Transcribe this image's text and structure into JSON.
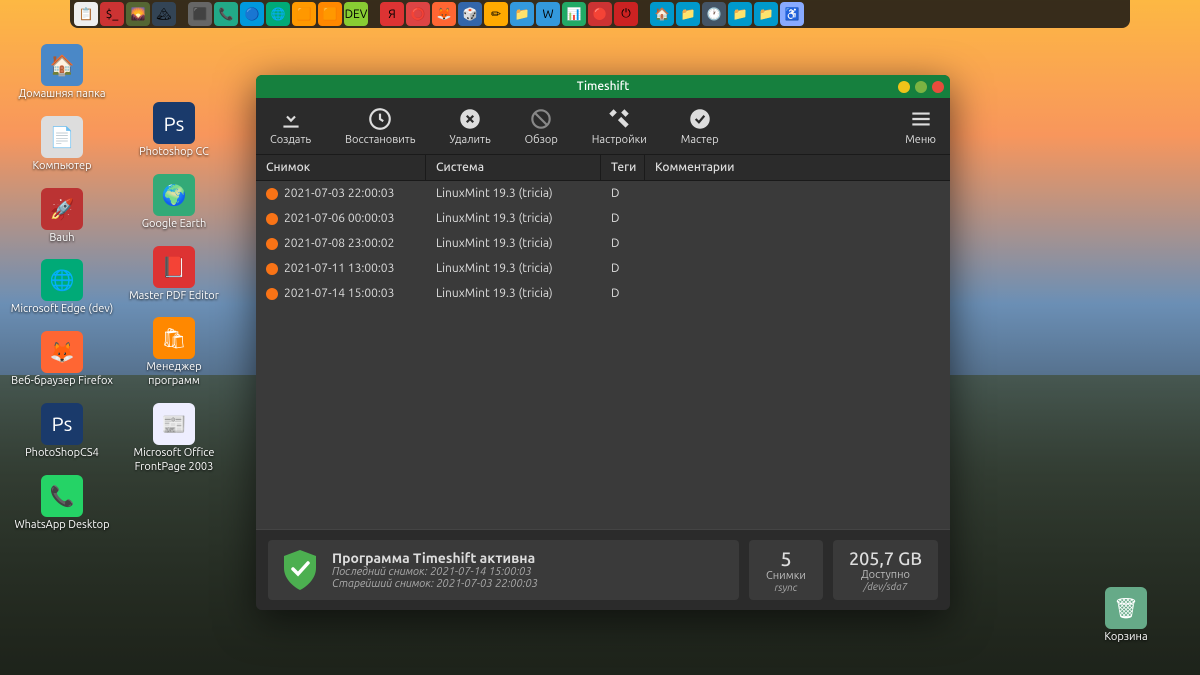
{
  "dock": {
    "items": [
      {
        "bg": "#eee",
        "emoji": "📋"
      },
      {
        "bg": "#c33",
        "emoji": "$_"
      },
      {
        "bg": "#563",
        "emoji": "🌄"
      },
      {
        "bg": "#345",
        "emoji": "🏔"
      },
      {
        "bg": "#666",
        "emoji": "⬛"
      },
      {
        "bg": "#2a8",
        "emoji": "📞"
      },
      {
        "bg": "#09d",
        "emoji": "🔵"
      },
      {
        "bg": "#0a7",
        "emoji": "🌐"
      },
      {
        "bg": "#f90",
        "emoji": "🟧"
      },
      {
        "bg": "#f80",
        "emoji": "🟧"
      },
      {
        "bg": "#8c3",
        "emoji": "DEV"
      },
      {
        "bg": "#d33",
        "emoji": "Я"
      },
      {
        "bg": "#d44",
        "emoji": "⭕"
      },
      {
        "bg": "#f63",
        "emoji": "🦊"
      },
      {
        "bg": "#36a",
        "emoji": "🎲"
      },
      {
        "bg": "#fa0",
        "emoji": "✏"
      },
      {
        "bg": "#39d",
        "emoji": "📁"
      },
      {
        "bg": "#39d",
        "emoji": "W"
      },
      {
        "bg": "#2a6",
        "emoji": "📊"
      },
      {
        "bg": "#c33",
        "emoji": "🔴"
      },
      {
        "bg": "#c22",
        "emoji": "⏻"
      },
      {
        "bg": "#09c",
        "emoji": "🏠"
      },
      {
        "bg": "#09c",
        "emoji": "📁"
      },
      {
        "bg": "#456",
        "emoji": "🕐"
      },
      {
        "bg": "#09c",
        "emoji": "📁"
      },
      {
        "bg": "#09c",
        "emoji": "📁"
      },
      {
        "bg": "#8af",
        "emoji": "♿"
      }
    ]
  },
  "desktop": {
    "col1": [
      {
        "label": "Домашняя папка",
        "bg": "#4a88c7",
        "emoji": "🏠"
      },
      {
        "label": "Компьютер",
        "bg": "#ddd",
        "emoji": "📄"
      },
      {
        "label": "Bauh",
        "bg": "#b33",
        "emoji": "🚀"
      },
      {
        "label": "Microsoft Edge (dev)",
        "bg": "#0a7",
        "emoji": "🌐"
      },
      {
        "label": "Веб-браузер Firefox",
        "bg": "#f63",
        "emoji": "🦊"
      },
      {
        "label": "PhotoShopCS4",
        "bg": "#1a3a6b",
        "emoji": "Ps"
      },
      {
        "label": "WhatsApp Desktop",
        "bg": "#25d366",
        "emoji": "📞"
      }
    ],
    "col2": [
      {
        "label": "",
        "bg": "transparent",
        "emoji": ""
      },
      {
        "label": "Photoshop CC",
        "bg": "#1a3a6b",
        "emoji": "Ps"
      },
      {
        "label": "Google Earth",
        "bg": "#3a7",
        "emoji": "🌍"
      },
      {
        "label": "Master PDF Editor",
        "bg": "#d33",
        "emoji": "📕"
      },
      {
        "label": "Менеджер программ",
        "bg": "#f80",
        "emoji": "🛍"
      },
      {
        "label": "Microsoft Office FrontPage 2003",
        "bg": "#eef",
        "emoji": "📰"
      }
    ],
    "trash": {
      "label": "Корзина"
    }
  },
  "window": {
    "title": "Timeshift",
    "controls": {
      "min": "#f0c419",
      "max": "#7cb342",
      "close": "#e74c3c"
    },
    "toolbar": [
      {
        "key": "create",
        "label": "Создать"
      },
      {
        "key": "restore",
        "label": "Восстановить"
      },
      {
        "key": "delete",
        "label": "Удалить"
      },
      {
        "key": "browse",
        "label": "Обзор"
      },
      {
        "key": "settings",
        "label": "Настройки"
      },
      {
        "key": "wizard",
        "label": "Мастер"
      }
    ],
    "menu_label": "Меню",
    "columns": {
      "snapshot": "Снимок",
      "system": "Система",
      "tags": "Теги",
      "comments": "Комментарии"
    },
    "rows": [
      {
        "date": "2021-07-03 22:00:03",
        "system": "LinuxMint 19.3 (tricia)",
        "tags": "D"
      },
      {
        "date": "2021-07-06 00:00:03",
        "system": "LinuxMint 19.3 (tricia)",
        "tags": "D"
      },
      {
        "date": "2021-07-08 23:00:02",
        "system": "LinuxMint 19.3 (tricia)",
        "tags": "D"
      },
      {
        "date": "2021-07-11 13:00:03",
        "system": "LinuxMint 19.3 (tricia)",
        "tags": "D"
      },
      {
        "date": "2021-07-14 15:00:03",
        "system": "LinuxMint 19.3 (tricia)",
        "tags": "D"
      }
    ],
    "status": {
      "title": "Программа Timeshift активна",
      "last": "Последний снимок: 2021-07-14 15:00:03",
      "oldest": "Старейший снимок: 2021-07-03 22:00:03",
      "count": "5",
      "count_label": "Снимки",
      "count_sub": "rsync",
      "avail": "205,7 GB",
      "avail_label": "Доступно",
      "avail_sub": "/dev/sda7"
    }
  }
}
